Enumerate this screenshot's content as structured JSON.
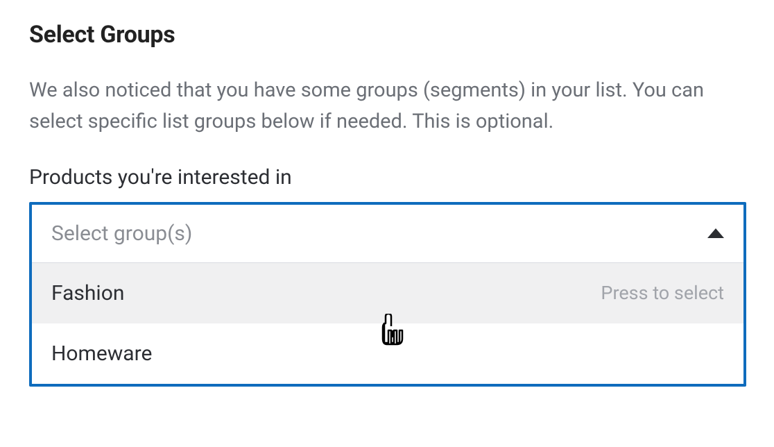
{
  "heading": "Select Groups",
  "description": "We also noticed that you have some groups (segments) in your list. You can select specific list groups below if needed. This is optional.",
  "field_label": "Products you're interested in",
  "dropdown": {
    "placeholder": "Select group(s)",
    "hint": "Press to select",
    "options": [
      {
        "label": "Fashion",
        "highlighted": true
      },
      {
        "label": "Homeware",
        "highlighted": false
      }
    ]
  }
}
